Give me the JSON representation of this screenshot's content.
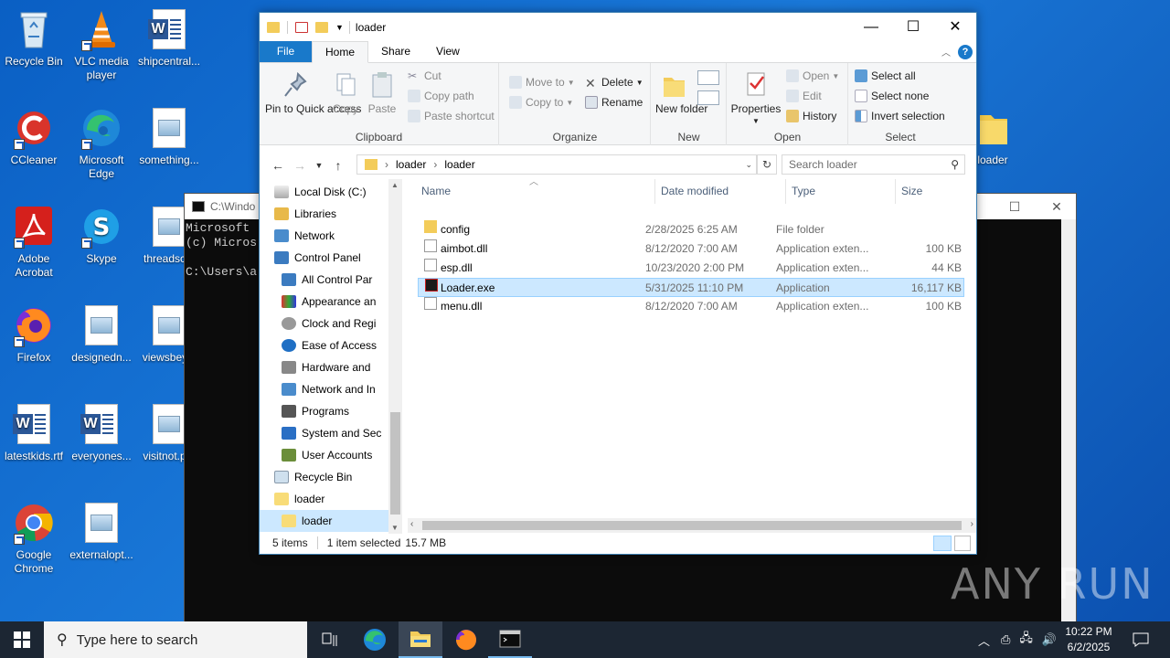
{
  "desktop": {
    "icons": [
      {
        "label": "Recycle Bin"
      },
      {
        "label": "VLC media player"
      },
      {
        "label": "shipcentral..."
      },
      {
        "label": "CCleaner"
      },
      {
        "label": "Microsoft Edge"
      },
      {
        "label": "something..."
      },
      {
        "label": "Adobe Acrobat"
      },
      {
        "label": "Skype"
      },
      {
        "label": "threadsc..."
      },
      {
        "label": "Firefox"
      },
      {
        "label": "designedn..."
      },
      {
        "label": "viewsbey..."
      },
      {
        "label": "latestkids.rtf"
      },
      {
        "label": "everyones..."
      },
      {
        "label": "visitnot.p..."
      },
      {
        "label": "Google Chrome"
      },
      {
        "label": "externalopt..."
      },
      {
        "label": "loader"
      }
    ]
  },
  "cmd": {
    "title": "C:\\Windo",
    "lines": "Microsoft \n(c) Micros\n\nC:\\Users\\a"
  },
  "explorer": {
    "title": "loader",
    "tabs": [
      "File",
      "Home",
      "Share",
      "View"
    ],
    "ribbon": {
      "clipboard": {
        "label": "Clipboard",
        "pin": "Pin to Quick access",
        "copy": "Copy",
        "paste": "Paste",
        "cut": "Cut",
        "copy_path": "Copy path",
        "paste_shortcut": "Paste shortcut"
      },
      "organize": {
        "label": "Organize",
        "move_to": "Move to",
        "copy_to": "Copy to",
        "delete": "Delete",
        "rename": "Rename"
      },
      "new": {
        "label": "New",
        "new_folder": "New folder"
      },
      "open": {
        "label": "Open",
        "properties": "Properties",
        "open": "Open",
        "edit": "Edit",
        "history": "History"
      },
      "select": {
        "label": "Select",
        "select_all": "Select all",
        "select_none": "Select none",
        "invert": "Invert selection"
      }
    },
    "address": {
      "parts": [
        "loader",
        "loader"
      ],
      "search_placeholder": "Search loader"
    },
    "nav": [
      {
        "label": "Local Disk (C:)"
      },
      {
        "label": "Libraries"
      },
      {
        "label": "Network"
      },
      {
        "label": "Control Panel"
      },
      {
        "label": "All Control Par"
      },
      {
        "label": "Appearance an"
      },
      {
        "label": "Clock and Regi"
      },
      {
        "label": "Ease of Access"
      },
      {
        "label": "Hardware and"
      },
      {
        "label": "Network and In"
      },
      {
        "label": "Programs"
      },
      {
        "label": "System and Sec"
      },
      {
        "label": "User Accounts"
      },
      {
        "label": "Recycle Bin"
      },
      {
        "label": "loader"
      },
      {
        "label": "loader"
      }
    ],
    "columns": [
      "Name",
      "Date modified",
      "Type",
      "Size"
    ],
    "files": [
      {
        "name": "config",
        "date": "2/28/2025 6:25 AM",
        "type": "File folder",
        "size": ""
      },
      {
        "name": "aimbot.dll",
        "date": "8/12/2020 7:00 AM",
        "type": "Application exten...",
        "size": "100 KB"
      },
      {
        "name": "esp.dll",
        "date": "10/23/2020 2:00 PM",
        "type": "Application exten...",
        "size": "44 KB"
      },
      {
        "name": "Loader.exe",
        "date": "5/31/2025 11:10 PM",
        "type": "Application",
        "size": "16,117 KB"
      },
      {
        "name": "menu.dll",
        "date": "8/12/2020 7:00 AM",
        "type": "Application exten...",
        "size": "100 KB"
      }
    ],
    "status": {
      "count": "5 items",
      "selected": "1 item selected",
      "size": "15.7 MB"
    }
  },
  "watermark": "ANY RUN",
  "taskbar": {
    "search_placeholder": "Type here to search",
    "time": "10:22 PM",
    "date": "6/2/2025"
  }
}
